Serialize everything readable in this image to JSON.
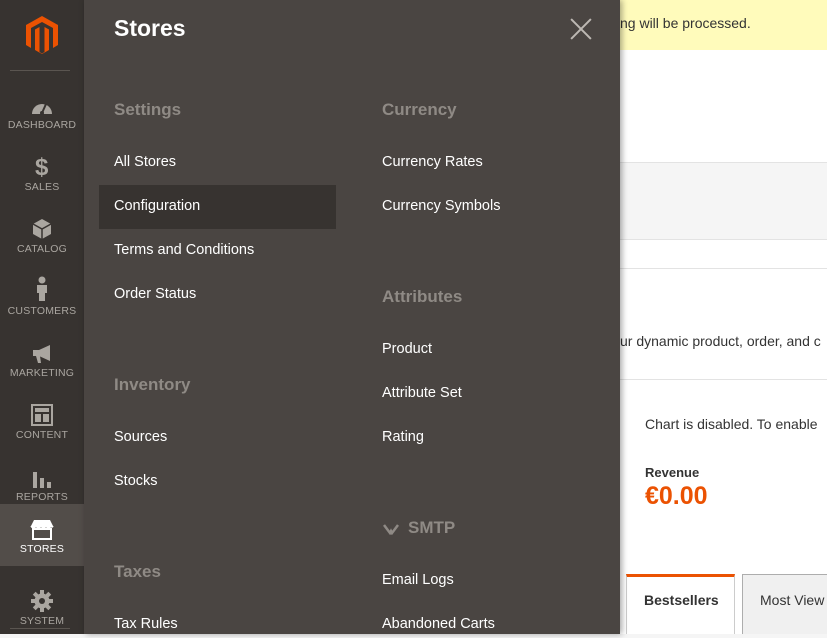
{
  "nav": {
    "items": [
      {
        "label": "DASHBOARD",
        "icon": "dashboard-icon"
      },
      {
        "label": "SALES",
        "icon": "dollar-icon"
      },
      {
        "label": "CATALOG",
        "icon": "cube-icon"
      },
      {
        "label": "CUSTOMERS",
        "icon": "person-icon"
      },
      {
        "label": "MARKETING",
        "icon": "megaphone-icon"
      },
      {
        "label": "CONTENT",
        "icon": "layout-icon"
      },
      {
        "label": "REPORTS",
        "icon": "bar-chart-icon"
      },
      {
        "label": "STORES",
        "icon": "store-icon"
      },
      {
        "label": "SYSTEM",
        "icon": "gear-icon"
      }
    ]
  },
  "flyout": {
    "title": "Stores",
    "settings": {
      "heading": "Settings",
      "links": [
        "All Stores",
        "Configuration",
        "Terms and Conditions",
        "Order Status"
      ]
    },
    "inventory": {
      "heading": "Inventory",
      "links": [
        "Sources",
        "Stocks"
      ]
    },
    "taxes": {
      "heading": "Taxes",
      "links": [
        "Tax Rules"
      ]
    },
    "currency": {
      "heading": "Currency",
      "links": [
        "Currency Rates",
        "Currency Symbols"
      ]
    },
    "attributes": {
      "heading": "Attributes",
      "links": [
        "Product",
        "Attribute Set",
        "Rating"
      ]
    },
    "smtp": {
      "heading": "SMTP",
      "links": [
        "Email Logs",
        "Abandoned Carts"
      ]
    }
  },
  "page": {
    "notice": "ng will be processed.",
    "description": "ur dynamic product, order, and c",
    "chart_message": "Chart is disabled. To enable",
    "revenue_label": "Revenue",
    "revenue_value": "€0.00",
    "tabs": [
      "Bestsellers",
      "Most View"
    ]
  },
  "colors": {
    "accent": "#eb5202",
    "nav_bg": "#373330",
    "flyout_bg": "#4a4542"
  }
}
